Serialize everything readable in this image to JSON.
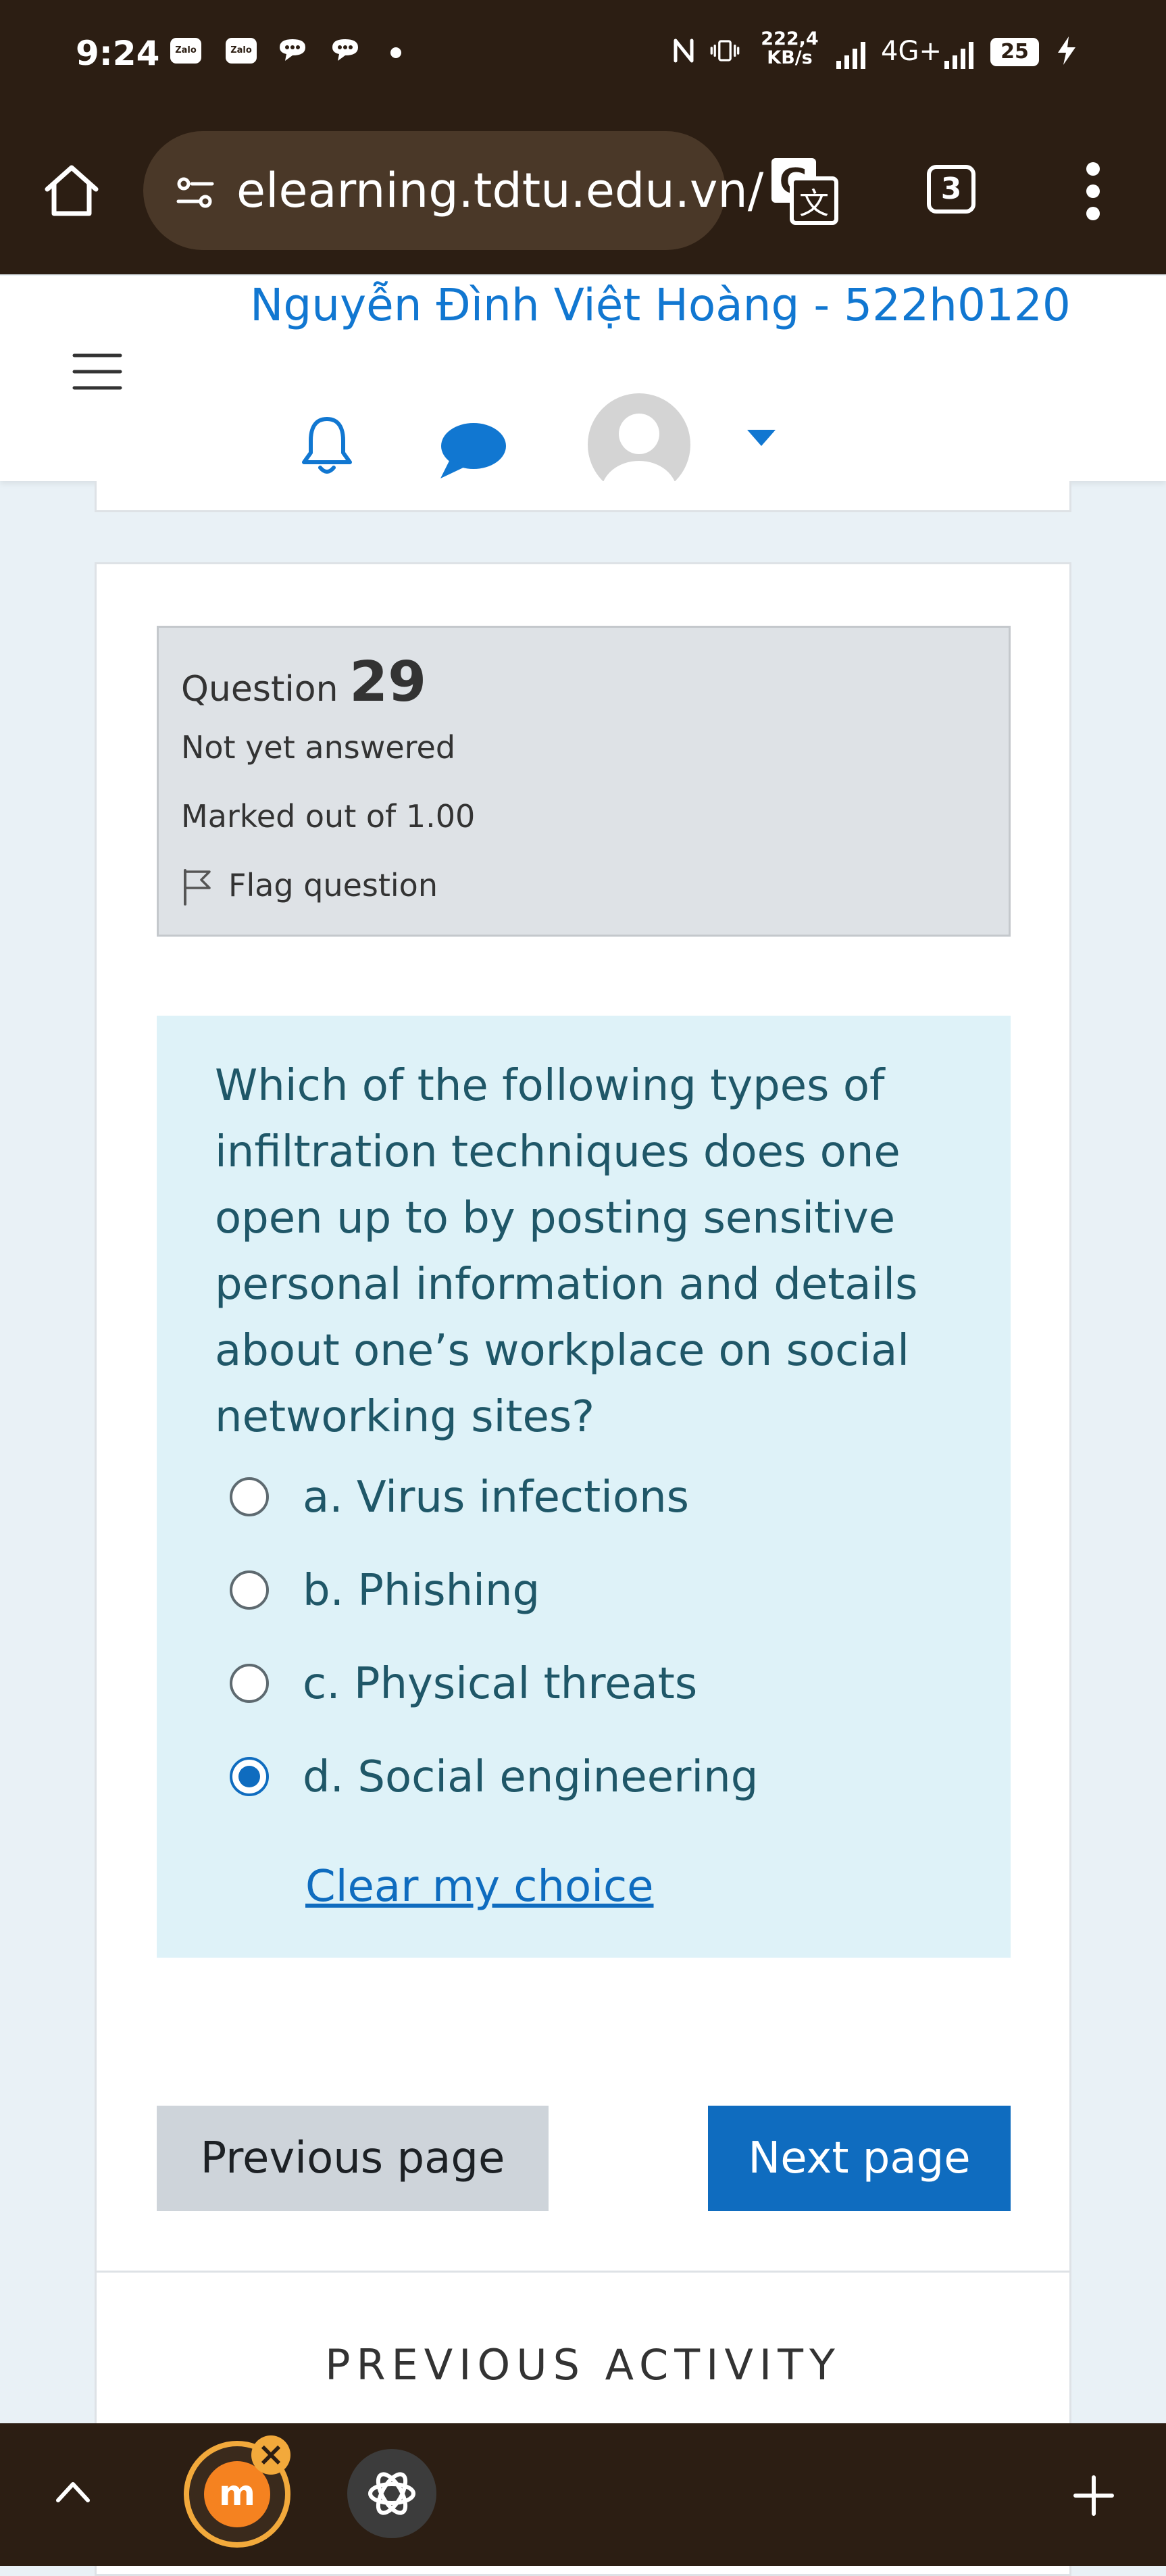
{
  "status_bar": {
    "time": "9:24",
    "zalo_label_1": "Zalo",
    "zalo_label_2": "Zalo",
    "network_speed": "222,4",
    "network_speed_unit": "KB/s",
    "network_type": "4G+",
    "battery_level": "25"
  },
  "browser": {
    "url": "elearning.tdtu.edu.vn/",
    "tab_count": "3"
  },
  "header": {
    "user_name": "Nguyễn Đình Việt Hoàng - 522h0120"
  },
  "question": {
    "label": "Question",
    "number": "29",
    "status": "Not yet answered",
    "marks": "Marked out of 1.00",
    "flag_label": "Flag question",
    "text": "Which of the following types of infiltration techniques does one open up to by posting sensitive personal information and details about one’s workplace on social networking sites?",
    "answers": [
      {
        "label": "a. Virus infections",
        "selected": false
      },
      {
        "label": "b. Phishing",
        "selected": false
      },
      {
        "label": "c. Physical threats",
        "selected": false
      },
      {
        "label": "d. Social engineering",
        "selected": true
      }
    ],
    "clear_choice": "Clear my choice"
  },
  "navigation": {
    "previous_label": "Previous page",
    "next_label": "Next page",
    "previous_activity_label": "PREVIOUS ACTIVITY"
  },
  "bottom_bar": {
    "moodle_app_letter": "m",
    "close_badge": "×"
  },
  "colors": {
    "accent": "#0f6cbf",
    "user_name": "#1177d1",
    "question_background": "#def2f8",
    "question_text": "#1f5768",
    "info_box_background": "#dee2e6",
    "browser_chrome": "#2c1e13",
    "moodle_orange": "#f58220"
  },
  "icons": {
    "status": [
      "zalo-icon",
      "zalo-icon",
      "messenger-icon",
      "messenger-icon",
      "nfc-icon",
      "vibrate-icon",
      "signal-icon",
      "battery-icon",
      "charging-icon"
    ],
    "toolbar": [
      "home-icon",
      "site-settings-icon",
      "translate-icon",
      "tabs-icon",
      "more-menu-icon"
    ],
    "header": [
      "hamburger-menu-icon",
      "bell-icon",
      "chat-bubble-icon",
      "avatar",
      "caret-down-icon"
    ],
    "question": [
      "flag-icon"
    ],
    "bottom_bar": [
      "chevron-up-icon",
      "moodle-app-icon",
      "chatgpt-icon",
      "plus-icon"
    ]
  }
}
